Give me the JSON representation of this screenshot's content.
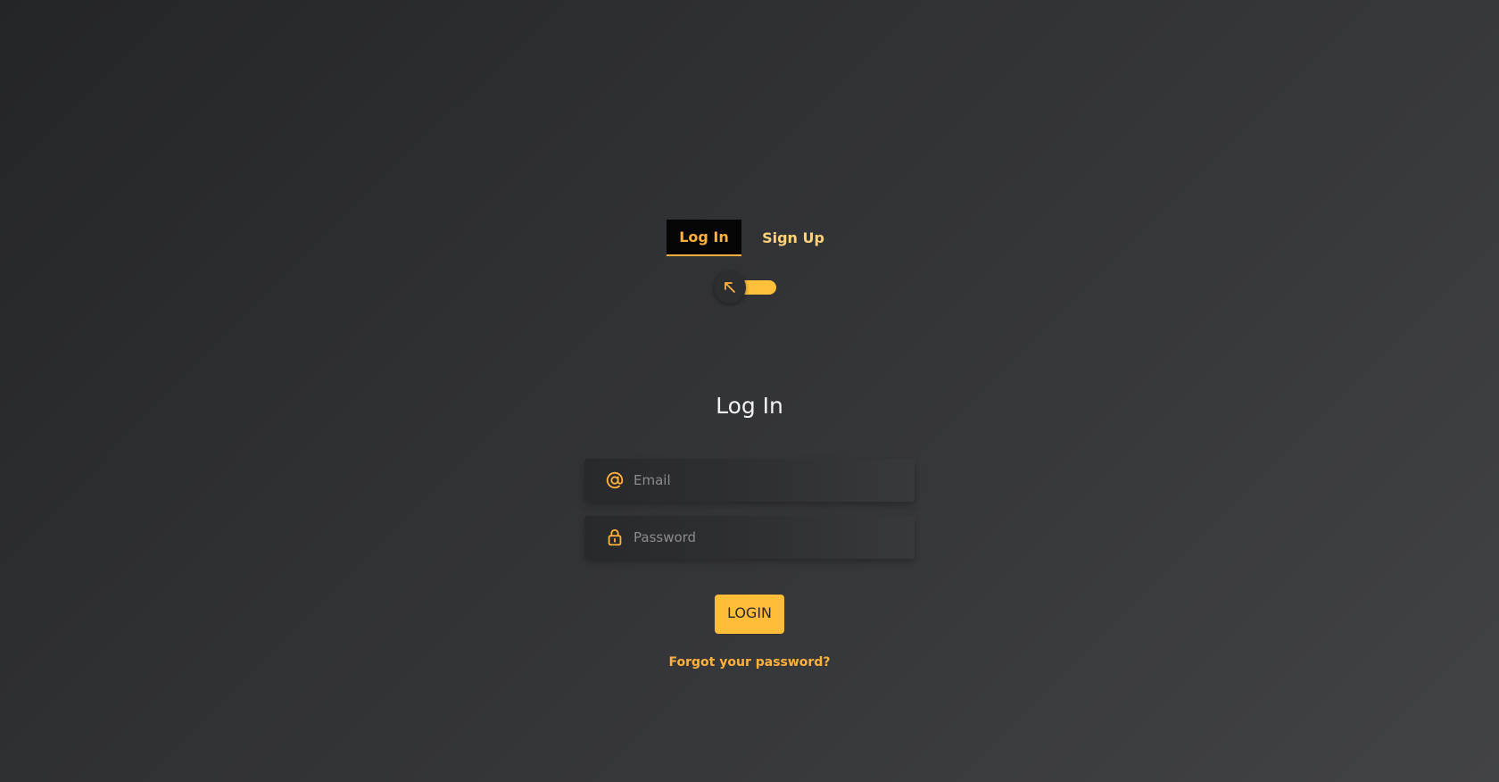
{
  "tabs": {
    "login_label": "Log In",
    "signup_label": "Sign Up"
  },
  "toggle": {
    "icon": "arrow-up-left-icon",
    "state": "login"
  },
  "form": {
    "heading": "Log In",
    "email": {
      "placeholder": "Email",
      "value": "",
      "icon": "at-sign-icon"
    },
    "password": {
      "placeholder": "Password",
      "value": "",
      "icon": "lock-icon"
    },
    "submit_label": "LOGIN",
    "forgot_label": "Forgot your password?"
  },
  "colors": {
    "accent": "#ffb13b",
    "button": "#ffbd3a",
    "active_tab_bg": "#050505"
  }
}
